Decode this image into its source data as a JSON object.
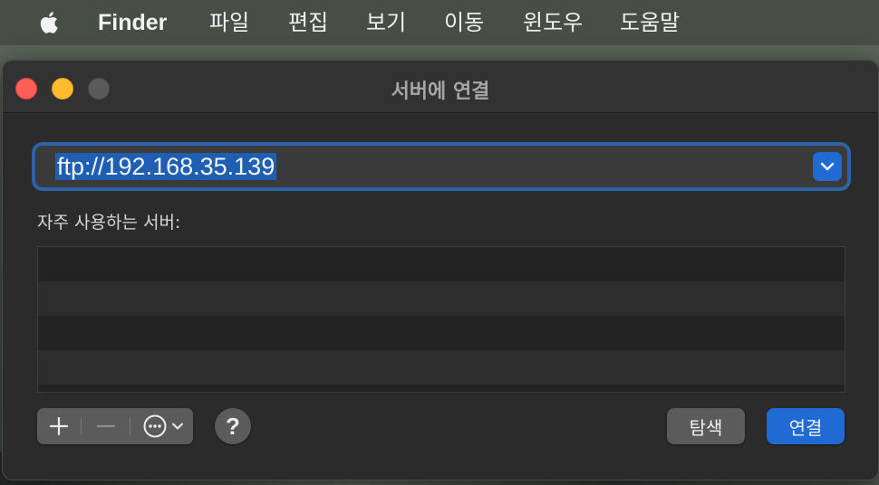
{
  "menubar": {
    "apple_icon": "apple-logo-icon",
    "app_name": "Finder",
    "items": [
      "파일",
      "편집",
      "보기",
      "이동",
      "윈도우",
      "도움말"
    ]
  },
  "dialog": {
    "title": "서버에 연결",
    "address_value": "ftp://192.168.35.139",
    "favorites_label": "자주 사용하는 서버:",
    "favorites": [],
    "add_icon": "plus-icon",
    "remove_icon": "minus-icon",
    "options_icon": "ellipsis-circle-icon",
    "help_label": "?",
    "browse_label": "탐색",
    "connect_label": "연결"
  },
  "colors": {
    "accent": "#1f6ad3",
    "close": "#fe5f57",
    "minimize": "#febc2e"
  }
}
